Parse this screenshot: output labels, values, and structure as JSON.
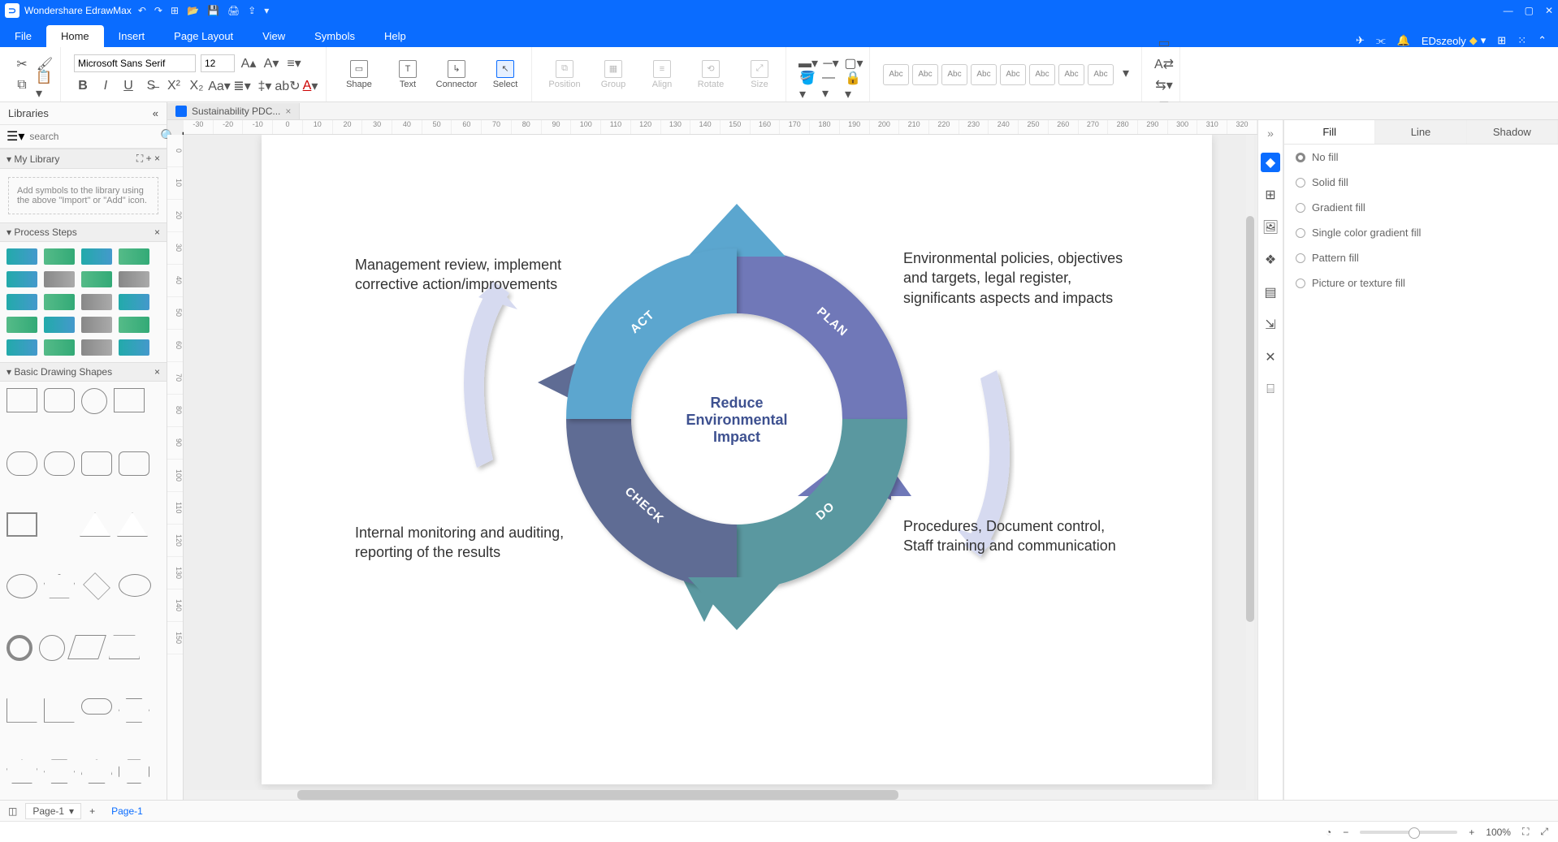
{
  "app": {
    "title": "Wondershare EdrawMax"
  },
  "menus": {
    "file": "File",
    "home": "Home",
    "insert": "Insert",
    "page_layout": "Page Layout",
    "view": "View",
    "symbols": "Symbols",
    "help": "Help"
  },
  "user": {
    "name": "EDszeoly"
  },
  "ribbon": {
    "font_family": "Microsoft Sans Serif",
    "font_size": "12",
    "shape": "Shape",
    "text": "Text",
    "connector": "Connector",
    "select": "Select",
    "position": "Position",
    "group": "Group",
    "align": "Align",
    "rotate": "Rotate",
    "size": "Size",
    "abc": "Abc"
  },
  "left": {
    "libraries": "Libraries",
    "search_ph": "search",
    "mylib": "My Library",
    "libmsg": "Add symbols to the library using the above \"Import\" or \"Add\" icon.",
    "process": "Process Steps",
    "basic": "Basic Drawing Shapes"
  },
  "doc_tab": "Sustainability PDC...",
  "ruler_marks": [
    "-30",
    "-20",
    "-10",
    "0",
    "10",
    "20",
    "30",
    "40",
    "50",
    "60",
    "70",
    "80",
    "90",
    "100",
    "110",
    "120",
    "130",
    "140",
    "150",
    "160",
    "170",
    "180",
    "190",
    "200",
    "210",
    "220",
    "230",
    "240",
    "250",
    "260",
    "270",
    "280",
    "290",
    "300",
    "310",
    "320"
  ],
  "ruler_v": [
    "0",
    "10",
    "20",
    "30",
    "40",
    "50",
    "60",
    "70",
    "80",
    "90",
    "100",
    "110",
    "120",
    "130",
    "140",
    "150"
  ],
  "diagram": {
    "center": "Reduce Environmental Impact",
    "plan": "PLAN",
    "do": "DO",
    "check": "CHECK",
    "act": "ACT",
    "plan_text": "Environmental policies, objectives and targets, legal register, significants aspects and impacts",
    "do_text": "Procedures, Document control, Staff training and communication",
    "check_text": "Internal monitoring and auditing, reporting of the results",
    "act_text": "Management review, implement corrective action/improvements"
  },
  "rpanel": {
    "fill": "Fill",
    "line": "Line",
    "shadow": "Shadow",
    "nofill": "No fill",
    "solid": "Solid fill",
    "gradient": "Gradient fill",
    "single": "Single color gradient fill",
    "pattern": "Pattern fill",
    "picture": "Picture or texture fill"
  },
  "pages": {
    "selector": "Page-1",
    "tab": "Page-1",
    "plus": "+"
  },
  "status": {
    "zoom": "100%"
  },
  "colors": [
    "#000",
    "#444",
    "#828282",
    "#b4b4b4",
    "#d8d8d8",
    "#fff",
    "#c00",
    "#e30",
    "#f60",
    "#f90",
    "#fc0",
    "#ff0",
    "#cf0",
    "#9f3",
    "#6c3",
    "#393",
    "#096",
    "#0c9",
    "#0cc",
    "#39c",
    "#06c",
    "#339",
    "#33c",
    "#63c",
    "#93c",
    "#c3c",
    "#c06",
    "#c39",
    "#ffd6d6",
    "#ffe0c0",
    "#fff0c0",
    "#d6ffd6",
    "#c0ffe8",
    "#c0f0ff",
    "#d0d8ff",
    "#e8d0ff",
    "#591d00",
    "#7a3b00",
    "#7a6200",
    "#2e5d00",
    "#005d46",
    "#004a7a",
    "#2a2a7a",
    "#5d007a",
    "#8c4a2a",
    "#a07030",
    "#8c8c4a",
    "#4a8c4a",
    "#4a8c8c",
    "#4a6a8c",
    "#6a4a8c",
    "#8c4a6a"
  ]
}
